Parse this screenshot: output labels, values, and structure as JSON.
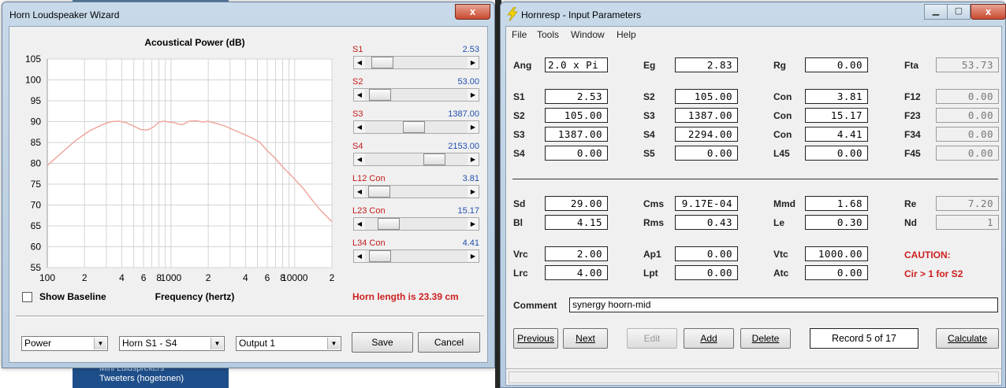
{
  "background": {
    "links": [
      "Mini Luidsprekers",
      "Tweeters (hogetonen)"
    ]
  },
  "wizard": {
    "title": "Horn Loudspeaker Wizard",
    "close_label": "x",
    "chart_data": {
      "type": "line",
      "title": "Acoustical Power (dB)",
      "xlabel": "Frequency (hertz)",
      "ylabel": "",
      "xscale": "log",
      "xlim": [
        100,
        20000
      ],
      "ylim": [
        55,
        105
      ],
      "yticks": [
        105,
        100,
        95,
        90,
        85,
        80,
        75,
        70,
        65,
        60,
        55
      ],
      "xtick_labels": [
        {
          "x": 100,
          "label": "100"
        },
        {
          "x": 200,
          "label": "2"
        },
        {
          "x": 400,
          "label": "4"
        },
        {
          "x": 600,
          "label": "6"
        },
        {
          "x": 800,
          "label": "8"
        },
        {
          "x": 1000,
          "label": "1000"
        },
        {
          "x": 2000,
          "label": "2"
        },
        {
          "x": 4000,
          "label": "4"
        },
        {
          "x": 6000,
          "label": "6"
        },
        {
          "x": 8000,
          "label": "8"
        },
        {
          "x": 10000,
          "label": "10000"
        },
        {
          "x": 20000,
          "label": "2"
        }
      ],
      "grid": true,
      "line_color": "#f0a8a0",
      "x": [
        100,
        130,
        170,
        220,
        280,
        330,
        380,
        430,
        500,
        570,
        650,
        720,
        800,
        880,
        950,
        1050,
        1150,
        1250,
        1400,
        1600,
        1800,
        2000,
        2300,
        2700,
        3200,
        3800,
        4500,
        5200,
        6000,
        7000,
        8000,
        9000,
        10000,
        12000,
        14000,
        16000,
        18000,
        20000
      ],
      "y": [
        79.5,
        82.5,
        85.5,
        87.8,
        89.3,
        90.0,
        90.1,
        89.8,
        88.9,
        88.1,
        88.0,
        88.7,
        89.9,
        90.1,
        89.9,
        89.8,
        89.4,
        89.3,
        90.1,
        90.2,
        89.9,
        90.1,
        89.6,
        89.0,
        88.0,
        87.1,
        86.1,
        85.1,
        83.0,
        81.1,
        79.1,
        77.6,
        76.2,
        73.6,
        71.0,
        68.9,
        67.4,
        66.0
      ]
    },
    "sliders": [
      {
        "label": "S1",
        "value": "2.53",
        "level": 0.08
      },
      {
        "label": "S2",
        "value": "53.00",
        "level": 0.05
      },
      {
        "label": "S3",
        "value": "1387.00",
        "level": 0.47
      },
      {
        "label": "S4",
        "value": "2153.00",
        "level": 0.73
      },
      {
        "label": "L12  Con",
        "value": "3.81",
        "level": 0.04
      },
      {
        "label": "L23  Con",
        "value": "15.17",
        "level": 0.16
      },
      {
        "label": "L34  Con",
        "value": "4.41",
        "level": 0.05
      }
    ],
    "show_baseline_label": "Show Baseline",
    "horn_length": "Horn length is 23.39 cm",
    "combo_type": "Power",
    "combo_horn": "Horn S1 - S4",
    "combo_output": "Output 1",
    "save_label": "Save",
    "cancel_label": "Cancel"
  },
  "hornresp": {
    "title": "Hornresp - Input Parameters",
    "close_label": "x",
    "menu": [
      "File",
      "Tools",
      "Window",
      "Help"
    ],
    "params_top": [
      [
        "Ang",
        "2.0 x Pi",
        "Eg",
        "2.83",
        "Rg",
        "0.00",
        "Fta",
        "53.73"
      ]
    ],
    "params_horn": [
      [
        "S1",
        "2.53",
        "S2",
        "105.00",
        "Con",
        "3.81",
        "F12",
        "0.00"
      ],
      [
        "S2",
        "105.00",
        "S3",
        "1387.00",
        "Con",
        "15.17",
        "F23",
        "0.00"
      ],
      [
        "S3",
        "1387.00",
        "S4",
        "2294.00",
        "Con",
        "4.41",
        "F34",
        "0.00"
      ],
      [
        "S4",
        "0.00",
        "S5",
        "0.00",
        "L45",
        "0.00",
        "F45",
        "0.00"
      ]
    ],
    "params_driver": [
      [
        "Sd",
        "29.00",
        "Cms",
        "9.17E-04",
        "Mmd",
        "1.68",
        "Re",
        "7.20"
      ],
      [
        "Bl",
        "4.15",
        "Rms",
        "0.43",
        "Le",
        "0.30",
        "Nd",
        "1"
      ]
    ],
    "params_chamber": [
      [
        "Vrc",
        "2.00",
        "Ap1",
        "0.00",
        "Vtc",
        "1000.00"
      ],
      [
        "Lrc",
        "4.00",
        "Lpt",
        "0.00",
        "Atc",
        "0.00"
      ]
    ],
    "caution_title": "CAUTION:",
    "caution_text": "Cir > 1 for S2",
    "comment_label": "Comment",
    "comment_value": "synergy hoorn-mid",
    "buttons": {
      "previous": "Previous",
      "next": "Next",
      "edit": "Edit",
      "add": "Add",
      "delete": "Delete",
      "calculate": "Calculate"
    },
    "record": "Record 5 of 17"
  }
}
